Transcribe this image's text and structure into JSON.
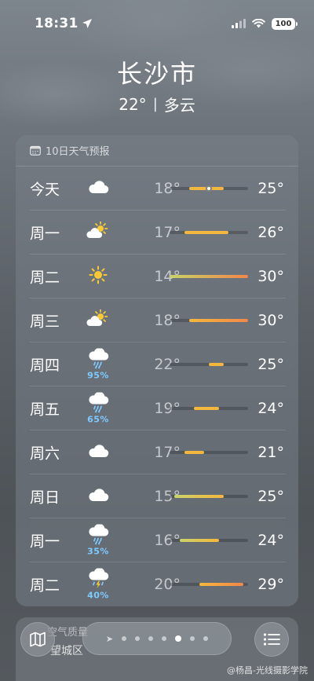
{
  "status_bar": {
    "time": "18:31",
    "battery": "100"
  },
  "header": {
    "city": "长沙市",
    "temp": "22°",
    "separator": "|",
    "condition": "多云"
  },
  "forecast": {
    "title": "10日天气预报",
    "days": [
      {
        "day": "今天",
        "icon": "cloud-icon",
        "pop": "",
        "low": "18°",
        "high": "25°",
        "low_val": 18,
        "high_val": 25,
        "current_val": 22
      },
      {
        "day": "周一",
        "icon": "partly-cloudy-icon",
        "pop": "",
        "low": "17°",
        "high": "26°",
        "low_val": 17,
        "high_val": 26
      },
      {
        "day": "周二",
        "icon": "sun-icon",
        "pop": "",
        "low": "14°",
        "high": "30°",
        "low_val": 14,
        "high_val": 30
      },
      {
        "day": "周三",
        "icon": "partly-cloudy-icon",
        "pop": "",
        "low": "18°",
        "high": "30°",
        "low_val": 18,
        "high_val": 30
      },
      {
        "day": "周四",
        "icon": "rain-icon",
        "pop": "95%",
        "low": "22°",
        "high": "25°",
        "low_val": 22,
        "high_val": 25
      },
      {
        "day": "周五",
        "icon": "rain-icon",
        "pop": "65%",
        "low": "19°",
        "high": "24°",
        "low_val": 19,
        "high_val": 24
      },
      {
        "day": "周六",
        "icon": "cloud-icon",
        "pop": "",
        "low": "17°",
        "high": "21°",
        "low_val": 17,
        "high_val": 21
      },
      {
        "day": "周日",
        "icon": "cloud-icon",
        "pop": "",
        "low": "15°",
        "high": "25°",
        "low_val": 15,
        "high_val": 25
      },
      {
        "day": "周一",
        "icon": "rain-icon",
        "pop": "35%",
        "low": "16°",
        "high": "24°",
        "low_val": 16,
        "high_val": 24
      },
      {
        "day": "周二",
        "icon": "thunderstorm-icon",
        "pop": "40%",
        "low": "20°",
        "high": "29°",
        "low_val": 20,
        "high_val": 29
      }
    ]
  },
  "air_quality": {
    "title": "空气质量",
    "location": "望城区"
  },
  "pager": {
    "pages": 7,
    "active_index": 4
  },
  "watermark": "@杨昌-光线摄影学院",
  "colors": {
    "pop": "#7ecbff",
    "bar_cool": "#c8d36a",
    "bar_warm": "#f4b73d",
    "bar_hot": "#f2874a"
  }
}
